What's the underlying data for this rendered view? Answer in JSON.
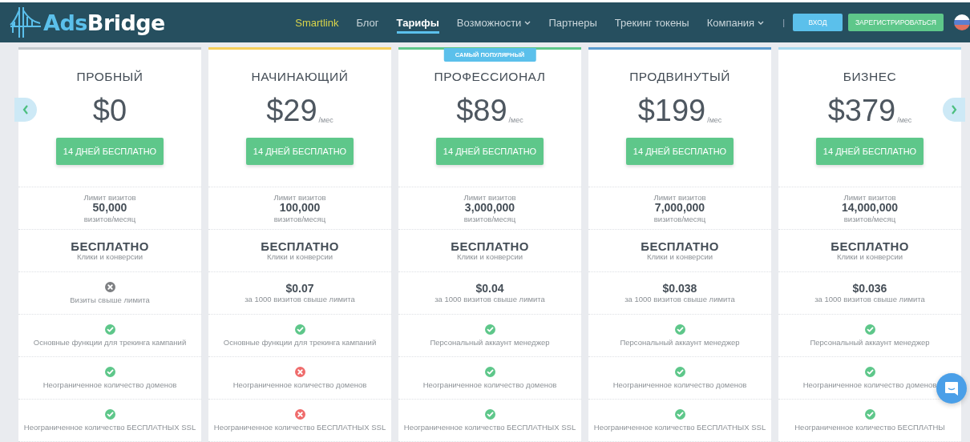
{
  "header": {
    "logo": {
      "first": "Ads",
      "second": "Bridge"
    },
    "nav": [
      {
        "label": "Smartlink",
        "selected": false,
        "highlighted": true,
        "dropdown": false
      },
      {
        "label": "Блог",
        "selected": false,
        "highlighted": false,
        "dropdown": false
      },
      {
        "label": "Тарифы",
        "selected": true,
        "highlighted": false,
        "dropdown": false
      },
      {
        "label": "Возможности",
        "selected": false,
        "highlighted": false,
        "dropdown": true
      },
      {
        "label": "Партнеры",
        "selected": false,
        "highlighted": false,
        "dropdown": false
      },
      {
        "label": "Трекинг токены",
        "selected": false,
        "highlighted": false,
        "dropdown": false
      },
      {
        "label": "Компания",
        "selected": false,
        "highlighted": false,
        "dropdown": true
      }
    ],
    "separator": "|",
    "login": "ВХОД",
    "register": "ЗАРЕГИСТРИРОВАТЬСЯ"
  },
  "plans": [
    {
      "name": "ПРОБНЫЙ",
      "color": "#c3c9cd",
      "price": "$0",
      "button": "14 ДНЕЙ БЕСПЛАТНО",
      "limit_label": "Лимит визитов",
      "limit_value": "50,000",
      "limit_unit": "визитов/месяц",
      "clicks_value": "БЕСПЛАТНО",
      "clicks_label": "Клики и конверсии",
      "overage": {
        "kind": "excluded",
        "text": "Визиты свыше лимита"
      },
      "features": [
        {
          "included": true,
          "text": "Основные функции для трекинга кампаний"
        },
        {
          "included": true,
          "text": "Неограниченное количество доменов"
        },
        {
          "included": true,
          "text": "Неограниченное количество БЕСПЛАТНЫХ SSL"
        }
      ]
    },
    {
      "name": "НАЧИНАЮЩИЙ",
      "color": "#f5cf5a",
      "price": "$29",
      "period": "/мес",
      "button": "14 ДНЕЙ БЕСПЛАТНО",
      "limit_label": "Лимит визитов",
      "limit_value": "100,000",
      "limit_unit": "визитов/месяц",
      "clicks_value": "БЕСПЛАТНО",
      "clicks_label": "Клики и конверсии",
      "overage": {
        "kind": "price",
        "value": "$0.07",
        "text": "за 1000 визитов свыше лимита"
      },
      "features": [
        {
          "included": true,
          "text": "Основные функции для трекинга кампаний"
        },
        {
          "included": false,
          "text": "Неограниченное количество доменов"
        },
        {
          "included": false,
          "text": "Неограниченное количество БЕСПЛАТНЫХ SSL"
        }
      ]
    },
    {
      "name": "ПРОФЕССИОНАЛ",
      "color": "#5ec78a",
      "badge": "САМЫЙ ПОПУЛЯРНЫЙ",
      "price": "$89",
      "period": "/мес",
      "button": "14 ДНЕЙ БЕСПЛАТНО",
      "limit_label": "Лимит визитов",
      "limit_value": "3,000,000",
      "limit_unit": "визитов/месяц",
      "clicks_value": "БЕСПЛАТНО",
      "clicks_label": "Клики и конверсии",
      "overage": {
        "kind": "price",
        "value": "$0.04",
        "text": "за 1000 визитов свыше лимита"
      },
      "features": [
        {
          "included": true,
          "text": "Персональный аккаунт менеджер"
        },
        {
          "included": true,
          "text": "Неограниченное количество доменов"
        },
        {
          "included": true,
          "text": "Неограниченное количество БЕСПЛАТНЫХ SSL"
        }
      ]
    },
    {
      "name": "ПРОДВИНУТЫЙ",
      "color": "#5b9ccf",
      "price": "$199",
      "period": "/мес",
      "button": "14 ДНЕЙ БЕСПЛАТНО",
      "limit_label": "Лимит визитов",
      "limit_value": "7,000,000",
      "limit_unit": "визитов/месяц",
      "clicks_value": "БЕСПЛАТНО",
      "clicks_label": "Клики и конверсии",
      "overage": {
        "kind": "price",
        "value": "$0.038",
        "text": "за 1000 визитов свыше лимита"
      },
      "features": [
        {
          "included": true,
          "text": "Персональный аккаунт менеджер"
        },
        {
          "included": true,
          "text": "Неограниченное количество доменов"
        },
        {
          "included": true,
          "text": "Неограниченное количество БЕСПЛАТНЫХ SSL"
        }
      ]
    },
    {
      "name": "БИЗНЕС",
      "color": "#a5d8ee",
      "price": "$379",
      "period": "/мес",
      "button": "14 ДНЕЙ БЕСПЛАТНО",
      "limit_label": "Лимит визитов",
      "limit_value": "14,000,000",
      "limit_unit": "визитов/месяц",
      "clicks_value": "БЕСПЛАТНО",
      "clicks_label": "Клики и конверсии",
      "overage": {
        "kind": "price",
        "value": "$0.036",
        "text": "за 1000 визитов свыше лимита"
      },
      "features": [
        {
          "included": true,
          "text": "Персональный аккаунт менеджер"
        },
        {
          "included": true,
          "text": "Неограниченное количество доменов"
        },
        {
          "included": true,
          "text": "Неограниченное количество БЕСПЛАТНЫ"
        }
      ]
    }
  ]
}
